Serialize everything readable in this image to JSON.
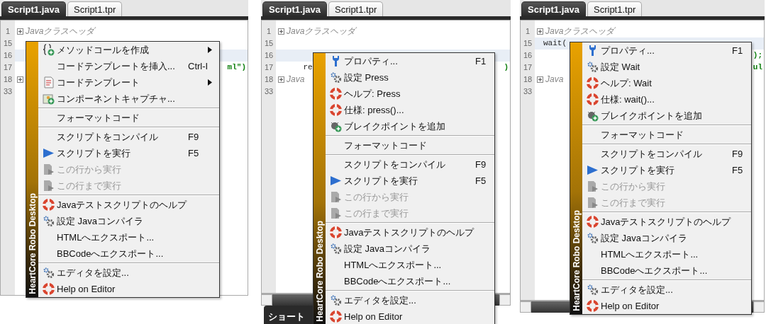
{
  "panels": [
    {
      "tabs": [
        {
          "label": "Script1.java",
          "selected": true
        },
        {
          "label": "Script1.tpr",
          "selected": false
        }
      ],
      "lines": [
        {
          "number": "1",
          "fold": true,
          "current": false,
          "kind": "comment",
          "text": "Javaクラスヘッダ"
        },
        {
          "number": "15",
          "fold": false,
          "current": false
        },
        {
          "number": "16",
          "fold": false,
          "current": true
        },
        {
          "number": "17",
          "fold": false,
          "current": false,
          "tail": "ml\")"
        },
        {
          "number": "18",
          "fold": true,
          "current": false
        },
        {
          "number": "33",
          "fold": false,
          "current": false
        }
      ],
      "menu": {
        "brand": "HeartCore Robo Desktop",
        "items": [
          {
            "kind": "item",
            "label": "メソッドコールを作成",
            "submenu": true,
            "disabled": false
          },
          {
            "kind": "item",
            "label": "コードテンプレートを挿入...",
            "shortcut": "Ctrl-I",
            "submenu": false,
            "disabled": false
          },
          {
            "kind": "item",
            "label": "コードテンプレート",
            "submenu": true,
            "disabled": false
          },
          {
            "kind": "item",
            "label": "コンポーネントキャプチャ...",
            "submenu": false,
            "disabled": false
          },
          {
            "kind": "separator"
          },
          {
            "kind": "item",
            "label": "フォーマットコード",
            "submenu": false,
            "disabled": false
          },
          {
            "kind": "separator"
          },
          {
            "kind": "item",
            "label": "スクリプトをコンパイル",
            "shortcut": "F9",
            "submenu": false,
            "disabled": false
          },
          {
            "kind": "item",
            "label": "スクリプトを実行",
            "shortcut": "F5",
            "submenu": false,
            "disabled": false
          },
          {
            "kind": "item",
            "label": "この行から実行",
            "submenu": false,
            "disabled": true
          },
          {
            "kind": "item",
            "label": "この行まで実行",
            "submenu": false,
            "disabled": true
          },
          {
            "kind": "separator"
          },
          {
            "kind": "item",
            "label": "Javaテストスクリプトのヘルプ",
            "submenu": false,
            "disabled": false
          },
          {
            "kind": "item",
            "label": "設定 Javaコンパイラ",
            "submenu": false,
            "disabled": false
          },
          {
            "kind": "item",
            "label": "HTMLへエクスポート...",
            "submenu": false,
            "disabled": false
          },
          {
            "kind": "item",
            "label": "BBCodeへエクスポート...",
            "submenu": false,
            "disabled": false
          },
          {
            "kind": "separator"
          },
          {
            "kind": "item",
            "label": "エディタを設定...",
            "submenu": false,
            "disabled": false
          },
          {
            "kind": "item",
            "label": "Help on Editor",
            "submenu": false,
            "disabled": false
          }
        ]
      }
    },
    {
      "tabs": [
        {
          "label": "Script1.java",
          "selected": true
        },
        {
          "label": "Script1.tpr",
          "selected": false
        }
      ],
      "lines": [
        {
          "number": "1",
          "fold": true,
          "current": false,
          "kind": "comment",
          "text": "Javaクラスヘッダ"
        },
        {
          "number": "15",
          "fold": false,
          "current": false
        },
        {
          "number": "16",
          "fold": false,
          "current": true
        },
        {
          "number": "17",
          "fold": false,
          "current": false,
          "kind": "code",
          "text": "    re",
          "tail": ")"
        },
        {
          "number": "18",
          "fold": true,
          "current": false,
          "kind": "comment",
          "text": "Java"
        },
        {
          "number": "33",
          "fold": false,
          "current": false
        }
      ],
      "scrollbar": true,
      "bottom_tab": "ショート",
      "menu": {
        "brand": "HeartCore Robo Desktop",
        "items": [
          {
            "kind": "item",
            "label": "プロパティ...",
            "shortcut": "F1",
            "submenu": false,
            "disabled": false
          },
          {
            "kind": "item",
            "label": "設定 Press",
            "submenu": false,
            "disabled": false
          },
          {
            "kind": "item",
            "label": "ヘルプ: Press",
            "submenu": false,
            "disabled": false
          },
          {
            "kind": "item",
            "label": "仕様: press()...",
            "submenu": false,
            "disabled": false
          },
          {
            "kind": "item",
            "label": "ブレイクポイントを追加",
            "submenu": false,
            "disabled": false
          },
          {
            "kind": "separator"
          },
          {
            "kind": "item",
            "label": "フォーマットコード",
            "submenu": false,
            "disabled": false
          },
          {
            "kind": "separator"
          },
          {
            "kind": "item",
            "label": "スクリプトをコンパイル",
            "shortcut": "F9",
            "submenu": false,
            "disabled": false
          },
          {
            "kind": "item",
            "label": "スクリプトを実行",
            "shortcut": "F5",
            "submenu": false,
            "disabled": false
          },
          {
            "kind": "item",
            "label": "この行から実行",
            "submenu": false,
            "disabled": true
          },
          {
            "kind": "item",
            "label": "この行まで実行",
            "submenu": false,
            "disabled": true
          },
          {
            "kind": "separator"
          },
          {
            "kind": "item",
            "label": "Javaテストスクリプトのヘルプ",
            "submenu": false,
            "disabled": false
          },
          {
            "kind": "item",
            "label": "設定 Javaコンパイラ",
            "submenu": false,
            "disabled": false
          },
          {
            "kind": "item",
            "label": "HTMLへエクスポート...",
            "submenu": false,
            "disabled": false
          },
          {
            "kind": "item",
            "label": "BBCodeへエクスポート...",
            "submenu": false,
            "disabled": false
          },
          {
            "kind": "separator"
          },
          {
            "kind": "item",
            "label": "エディタを設定...",
            "submenu": false,
            "disabled": false
          },
          {
            "kind": "item",
            "label": "Help on Editor",
            "submenu": false,
            "disabled": false
          }
        ]
      }
    },
    {
      "tabs": [
        {
          "label": "Script1.java",
          "selected": true
        },
        {
          "label": "Script1.tpr",
          "selected": false
        }
      ],
      "lines": [
        {
          "number": "1",
          "fold": true,
          "current": false,
          "kind": "comment",
          "text": "Javaクラスヘッダ"
        },
        {
          "number": "15",
          "fold": false,
          "current": true,
          "kind": "code",
          "text": "wait("
        },
        {
          "number": "16",
          "fold": false,
          "current": false,
          "tail": ");"
        },
        {
          "number": "17",
          "fold": false,
          "current": false,
          "tail": "ul"
        },
        {
          "number": "18",
          "fold": true,
          "current": false,
          "kind": "comment",
          "text": "Java"
        },
        {
          "number": "33",
          "fold": false,
          "current": false
        }
      ],
      "scrollbar": true,
      "menu": {
        "brand": "HeartCore Robo Desktop",
        "items": [
          {
            "kind": "item",
            "label": "プロパティ...",
            "shortcut": "F1",
            "submenu": false,
            "disabled": false
          },
          {
            "kind": "item",
            "label": "設定 Wait",
            "submenu": false,
            "disabled": false
          },
          {
            "kind": "item",
            "label": "ヘルプ: Wait",
            "submenu": false,
            "disabled": false
          },
          {
            "kind": "item",
            "label": "仕様: wait()...",
            "submenu": false,
            "disabled": false
          },
          {
            "kind": "item",
            "label": "ブレイクポイントを追加",
            "submenu": false,
            "disabled": false
          },
          {
            "kind": "separator"
          },
          {
            "kind": "item",
            "label": "フォーマットコード",
            "submenu": false,
            "disabled": false
          },
          {
            "kind": "separator"
          },
          {
            "kind": "item",
            "label": "スクリプトをコンパイル",
            "shortcut": "F9",
            "submenu": false,
            "disabled": false
          },
          {
            "kind": "item",
            "label": "スクリプトを実行",
            "shortcut": "F5",
            "submenu": false,
            "disabled": false
          },
          {
            "kind": "item",
            "label": "この行から実行",
            "submenu": false,
            "disabled": true
          },
          {
            "kind": "item",
            "label": "この行まで実行",
            "submenu": false,
            "disabled": true
          },
          {
            "kind": "separator"
          },
          {
            "kind": "item",
            "label": "Javaテストスクリプトのヘルプ",
            "submenu": false,
            "disabled": false
          },
          {
            "kind": "item",
            "label": "設定 Javaコンパイラ",
            "submenu": false,
            "disabled": false
          },
          {
            "kind": "item",
            "label": "HTMLへエクスポート...",
            "submenu": false,
            "disabled": false
          },
          {
            "kind": "item",
            "label": "BBCodeへエクスポート...",
            "submenu": false,
            "disabled": false
          },
          {
            "kind": "separator"
          },
          {
            "kind": "item",
            "label": "エディタを設定...",
            "submenu": false,
            "disabled": false
          },
          {
            "kind": "item",
            "label": "Help on Editor",
            "submenu": false,
            "disabled": false
          }
        ]
      }
    }
  ]
}
